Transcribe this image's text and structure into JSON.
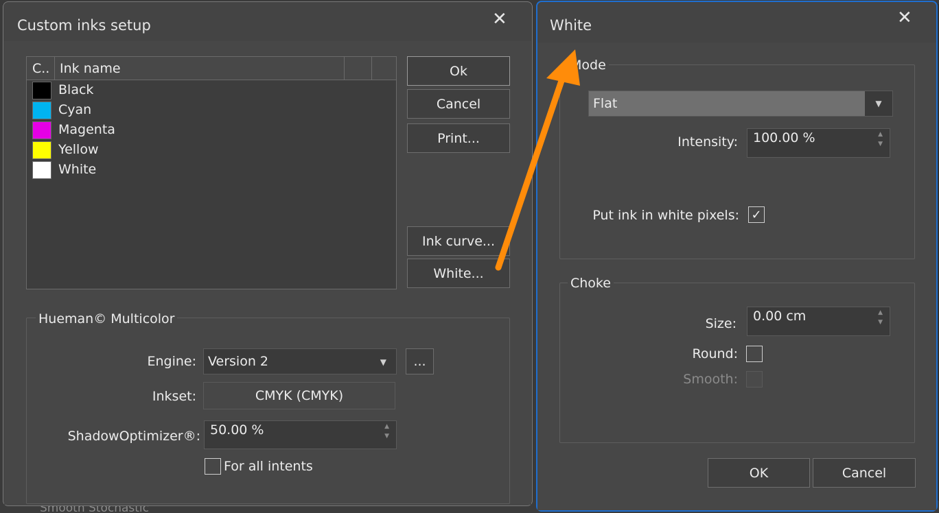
{
  "background": {
    "status_text": "Smooth Stochastic"
  },
  "custom_inks_dialog": {
    "title": "Custom inks setup",
    "close_label": "✕",
    "table": {
      "columns": [
        "C..",
        "Ink name"
      ],
      "rows": [
        {
          "name": "Black",
          "color": "#000000"
        },
        {
          "name": "Cyan",
          "color": "#00b4f0"
        },
        {
          "name": "Magenta",
          "color": "#e600e6"
        },
        {
          "name": "Yellow",
          "color": "#ffff00"
        },
        {
          "name": "White",
          "color": "#ffffff"
        }
      ]
    },
    "buttons": {
      "ok": "Ok",
      "cancel": "Cancel",
      "print": "Print...",
      "ink_curve": "Ink curve...",
      "white": "White..."
    },
    "multicolor": {
      "group_title": "Hueman© Multicolor",
      "engine_label": "Engine:",
      "engine_value": "Version 2",
      "engine_more": "...",
      "inkset_label": "Inkset:",
      "inkset_value": "CMYK (CMYK)",
      "shadow_label": "ShadowOptimizer®:",
      "shadow_value": "50.00 %",
      "for_all_intents_label": "For all intents",
      "for_all_intents_checked": false
    }
  },
  "white_dialog": {
    "title": "White",
    "close_label": "✕",
    "mode": {
      "group_title": "Mode",
      "mode_value": "Flat",
      "intensity_label": "Intensity:",
      "intensity_value": "100.00 %",
      "put_ink_label": "Put ink in white pixels:",
      "put_ink_checked": true
    },
    "choke": {
      "group_title": "Choke",
      "size_label": "Size:",
      "size_value": "0.00 cm",
      "round_label": "Round:",
      "round_checked": false,
      "smooth_label": "Smooth:",
      "smooth_checked": false
    },
    "buttons": {
      "ok": "OK",
      "cancel": "Cancel"
    }
  },
  "annotation": {
    "arrow_color": "#ff8c0a"
  },
  "icons": {
    "check": "✓",
    "caret_down": "▼",
    "spin_up": "▲",
    "spin_down": "▼"
  }
}
